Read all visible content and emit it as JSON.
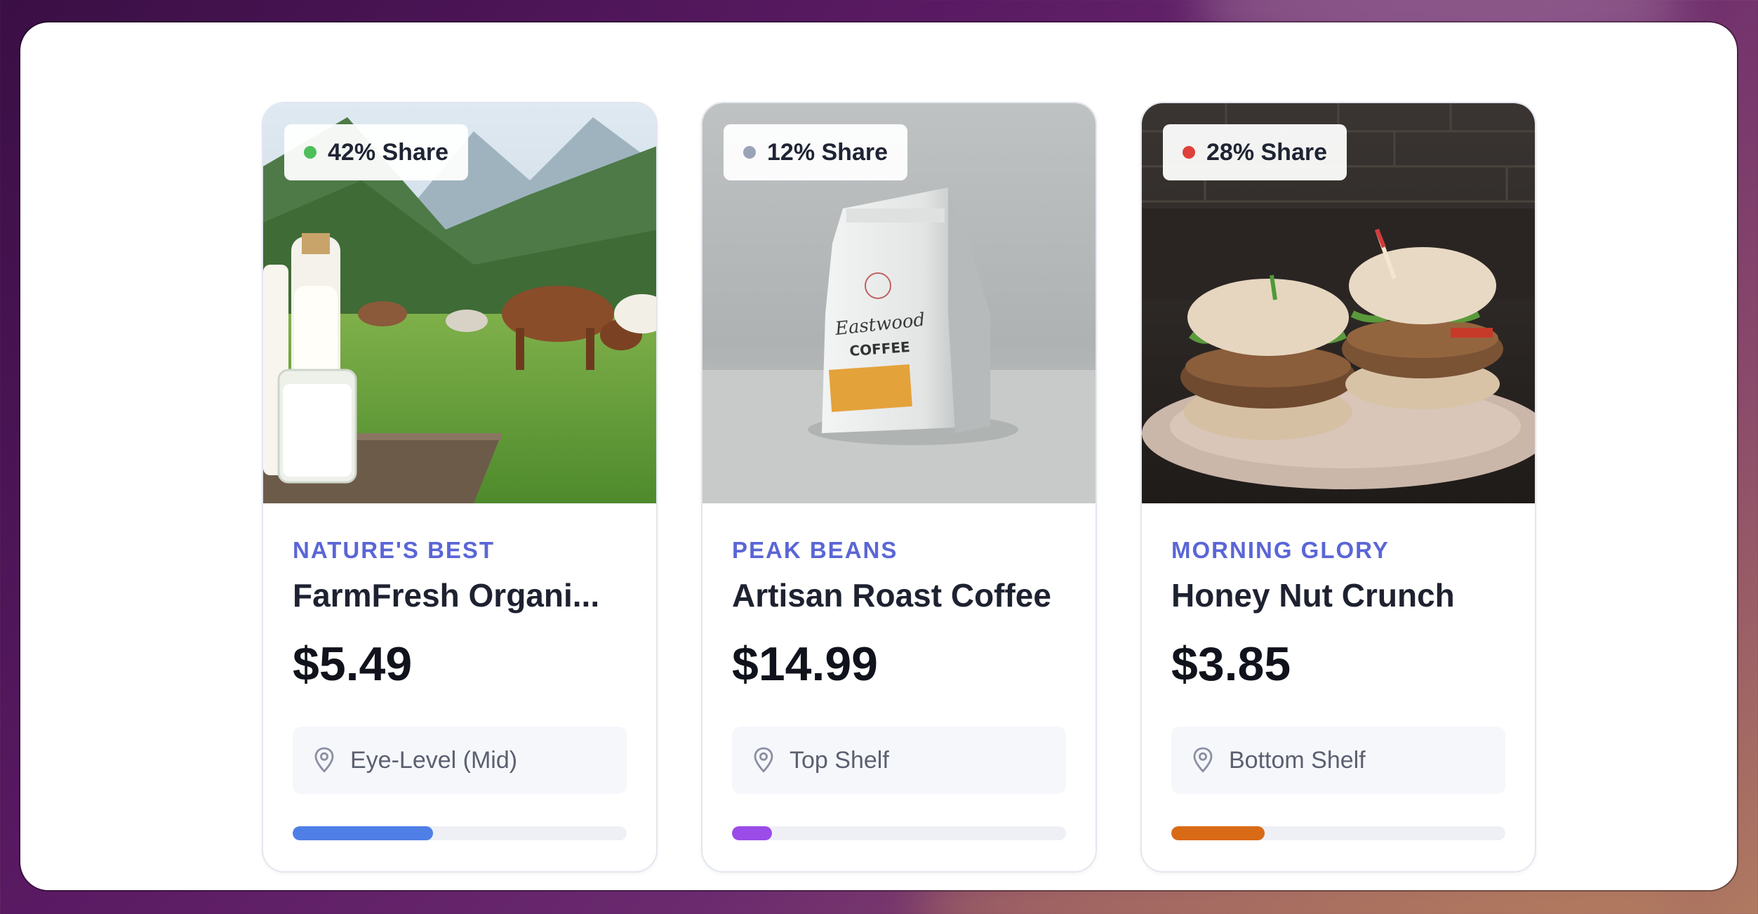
{
  "cards": [
    {
      "share_label": "42% Share",
      "share_dot_color": "#4cbf5a",
      "brand": "NATURE'S BEST",
      "name": "FarmFresh Organi...",
      "price": "$5.49",
      "shelf_icon": "map-pin-icon",
      "shelf": "Eye-Level (Mid)",
      "share_progress": 0.42,
      "bar_color": "#4f7fe6",
      "image": "milk-bottles-cows-pasture"
    },
    {
      "share_label": "12% Share",
      "share_dot_color": "#9aa3b8",
      "brand": "PEAK BEANS",
      "name": "Artisan Roast Coffee",
      "price": "$14.99",
      "shelf_icon": "map-pin-icon",
      "shelf": "Top Shelf",
      "share_progress": 0.12,
      "bar_color": "#9a4be8",
      "image": "coffee-bag"
    },
    {
      "share_label": "28% Share",
      "share_dot_color": "#e0403a",
      "brand": "MORNING GLORY",
      "name": "Honey Nut Crunch",
      "price": "$3.85",
      "shelf_icon": "map-pin-icon",
      "shelf": "Bottom Shelf",
      "share_progress": 0.28,
      "bar_color": "#d96a16",
      "image": "burgers-on-plate"
    }
  ]
}
